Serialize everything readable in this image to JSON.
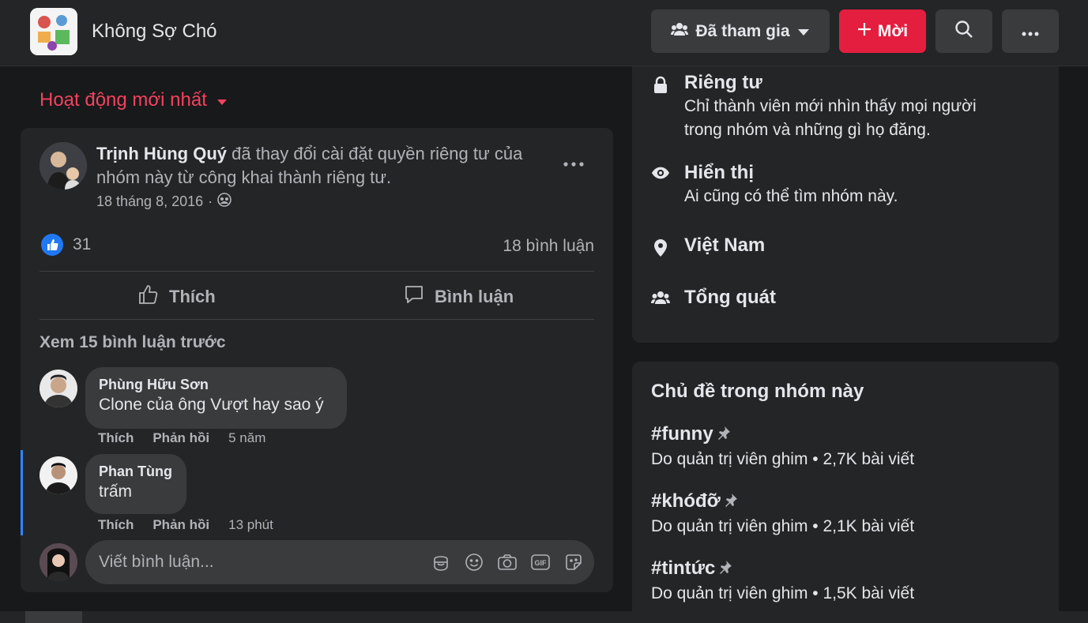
{
  "header": {
    "group_name": "Không Sợ Chó",
    "joined_label": "Đã tham gia",
    "invite_label": "Mời",
    "accent_invite": "#e41e3f"
  },
  "feed": {
    "sort_label": "Hoạt động mới nhất",
    "post": {
      "author": "Trịnh Hùng Quý",
      "text": "đã thay đổi cài đặt quyền riêng tư của nhóm này từ công khai thành riêng tư.",
      "date": "18 tháng 8, 2016",
      "audience_icon": "group-audience-icon",
      "like_count": "31",
      "comment_count": "18 bình luận",
      "like_label": "Thích",
      "comment_label": "Bình luận",
      "prev_comments_label": "Xem 15 bình luận trước",
      "comments": [
        {
          "name": "Phùng Hữu Sơn",
          "text": "Clone của ông Vượt hay sao ý",
          "like": "Thích",
          "reply": "Phản hồi",
          "time": "5 năm"
        },
        {
          "name": "Phan Tùng",
          "text": "trấm",
          "like": "Thích",
          "reply": "Phản hồi",
          "time": "13 phút"
        }
      ],
      "comment_placeholder": "Viết bình luận..."
    }
  },
  "about": {
    "privacy_title": "Riêng tư",
    "privacy_desc": "Chỉ thành viên mới nhìn thấy mọi người trong nhóm và những gì họ đăng.",
    "visibility_title": "Hiển thị",
    "visibility_desc": "Ai cũng có thể tìm nhóm này.",
    "location": "Việt Nam",
    "category": "Tổng quát"
  },
  "topics": {
    "title": "Chủ đề trong nhóm này",
    "items": [
      {
        "tag": "#funny",
        "meta": "Do quản trị viên ghim • 2,7K bài viết"
      },
      {
        "tag": "#khóđỡ",
        "meta": "Do quản trị viên ghim • 2,1K bài viết"
      },
      {
        "tag": "#tintức",
        "meta": "Do quản trị viên ghim • 1,5K bài viết"
      }
    ]
  }
}
